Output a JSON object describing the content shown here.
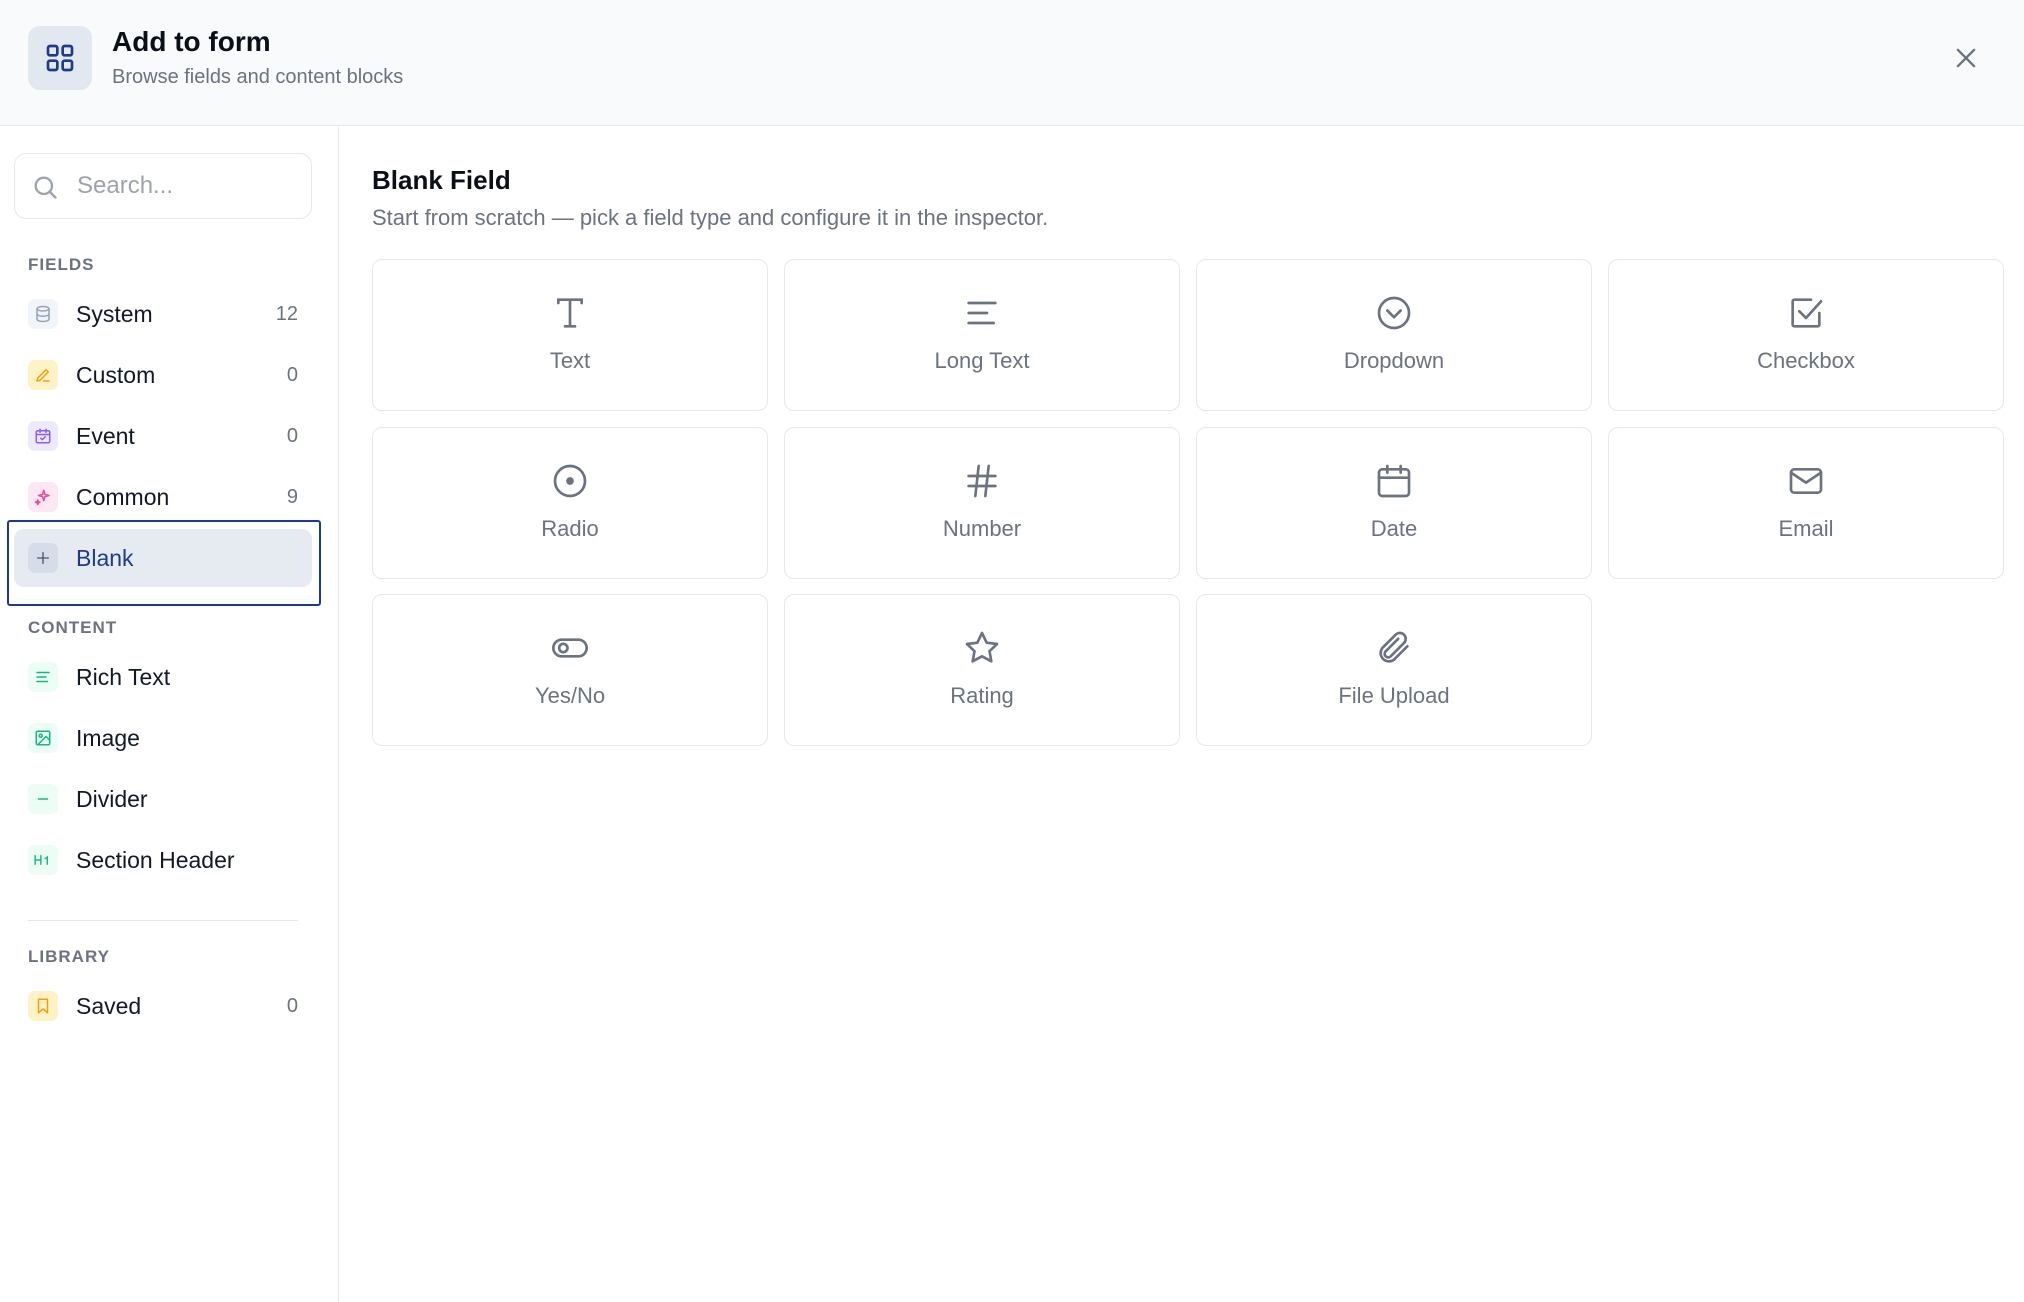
{
  "header": {
    "title": "Add to form",
    "subtitle": "Browse fields and content blocks"
  },
  "search": {
    "placeholder": "Search..."
  },
  "sidebar": {
    "fields_label": "FIELDS",
    "fields": [
      {
        "label": "System",
        "count": "12",
        "icon": "database-icon",
        "color": "#94a3b8"
      },
      {
        "label": "Custom",
        "count": "0",
        "icon": "pencil-icon",
        "color": "#f59e0b"
      },
      {
        "label": "Event",
        "count": "0",
        "icon": "calendar-check-icon",
        "color": "#8b5cf6"
      },
      {
        "label": "Common",
        "count": "9",
        "icon": "sparkles-icon",
        "color": "#ec4899"
      },
      {
        "label": "Blank",
        "count": "",
        "icon": "plus-icon",
        "color": "#475569",
        "active": true
      }
    ],
    "content_label": "CONTENT",
    "content": [
      {
        "label": "Rich Text",
        "icon": "text-lines-icon",
        "color": "#10b981"
      },
      {
        "label": "Image",
        "icon": "image-icon",
        "color": "#10b981"
      },
      {
        "label": "Divider",
        "icon": "minus-icon",
        "color": "#10b981"
      },
      {
        "label": "Section Header",
        "icon": "heading-icon",
        "color": "#10b981"
      }
    ],
    "library_label": "LIBRARY",
    "library": [
      {
        "label": "Saved",
        "count": "0",
        "icon": "bookmark-icon",
        "color": "#f59e0b"
      }
    ]
  },
  "main": {
    "title": "Blank Field",
    "description": "Start from scratch — pick a field type and configure it in the inspector.",
    "cards": [
      {
        "label": "Text",
        "icon": "text-type-icon"
      },
      {
        "label": "Long Text",
        "icon": "align-left-icon"
      },
      {
        "label": "Dropdown",
        "icon": "chevron-circle-icon"
      },
      {
        "label": "Checkbox",
        "icon": "checkbox-icon"
      },
      {
        "label": "Radio",
        "icon": "radio-icon"
      },
      {
        "label": "Number",
        "icon": "hash-icon"
      },
      {
        "label": "Date",
        "icon": "calendar-icon"
      },
      {
        "label": "Email",
        "icon": "mail-icon"
      },
      {
        "label": "Yes/No",
        "icon": "toggle-icon"
      },
      {
        "label": "Rating",
        "icon": "star-icon"
      },
      {
        "label": "File Upload",
        "icon": "paperclip-icon"
      }
    ]
  },
  "colors": {
    "accent": "#1e3a8a",
    "header_bg": "#f8fafc",
    "active_bg": "#e6ebf2"
  }
}
